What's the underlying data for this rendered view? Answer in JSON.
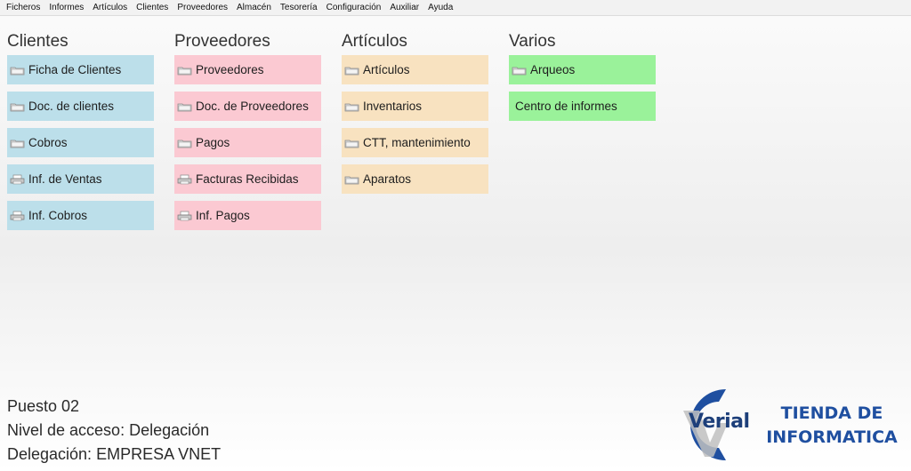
{
  "menu": [
    "Ficheros",
    "Informes",
    "Artículos",
    "Clientes",
    "Proveedores",
    "Almacén",
    "Tesorería",
    "Configuración",
    "Auxiliar",
    "Ayuda"
  ],
  "columns": [
    {
      "title": "Clientes",
      "items": [
        "Ficha de Clientes",
        "Doc. de clientes",
        "Cobros",
        "Inf. de Ventas",
        "Inf. Cobros"
      ]
    },
    {
      "title": "Proveedores",
      "items": [
        "Proveedores",
        "Doc. de Proveedores",
        "Pagos",
        "Facturas Recibidas",
        "Inf. Pagos"
      ]
    },
    {
      "title": "Artículos",
      "items": [
        "Artículos",
        "Inventarios",
        "CTT, mantenimiento",
        "Aparatos"
      ]
    },
    {
      "title": "Varios",
      "items": [
        "Arqueos",
        "Centro de informes"
      ]
    }
  ],
  "status": {
    "puesto": "Puesto 02",
    "nivel": "Nivel de acceso: Delegación",
    "delegacion": "Delegación: EMPRESA VNET"
  },
  "brand": {
    "logo_word": "Verial",
    "line1": "TIENDA DE",
    "line2": "INFORMATICA"
  },
  "colors": {
    "clientes": "#bcdfea",
    "proveedores": "#fbc9d2",
    "articulos": "#f8e2c0",
    "varios": "#9af29a",
    "brand": "#1f4fa0"
  }
}
